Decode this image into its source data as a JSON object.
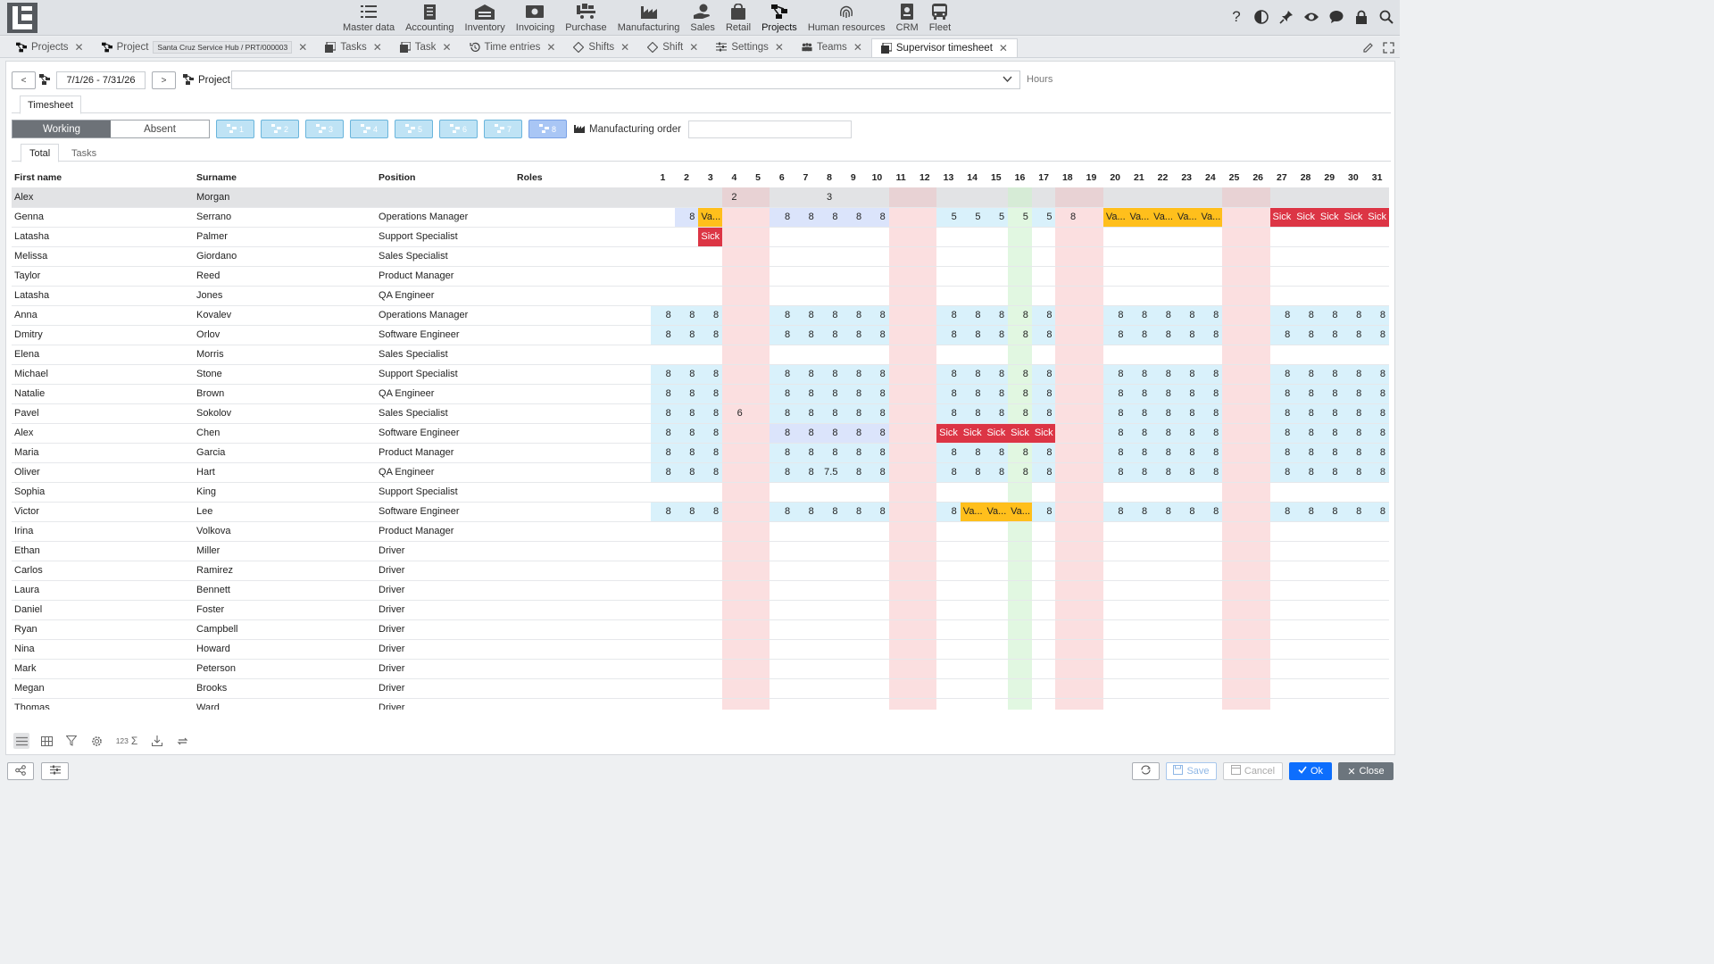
{
  "modules": [
    {
      "label": "Master data",
      "icon": "list-icon"
    },
    {
      "label": "Accounting",
      "icon": "ledger-icon"
    },
    {
      "label": "Inventory",
      "icon": "warehouse-icon"
    },
    {
      "label": "Invoicing",
      "icon": "money-icon"
    },
    {
      "label": "Purchase",
      "icon": "cart-icon"
    },
    {
      "label": "Manufacturing",
      "icon": "factory-icon"
    },
    {
      "label": "Sales",
      "icon": "hand-money-icon"
    },
    {
      "label": "Retail",
      "icon": "bag-icon"
    },
    {
      "label": "Projects",
      "icon": "hierarchy-icon"
    },
    {
      "label": "Human resources",
      "icon": "fingerprint-icon"
    },
    {
      "label": "CRM",
      "icon": "badge-icon"
    },
    {
      "label": "Fleet",
      "icon": "bus-icon"
    }
  ],
  "tabs": [
    {
      "label": "Projects",
      "icon": "hierarchy-icon"
    },
    {
      "label": "Project",
      "icon": "hierarchy-icon",
      "pill": "Santa Cruz Service Hub / PRT/000003"
    },
    {
      "label": "Tasks",
      "icon": "tasks-icon"
    },
    {
      "label": "Task",
      "icon": "tasks-icon"
    },
    {
      "label": "Time entries",
      "icon": "history-icon"
    },
    {
      "label": "Shifts",
      "icon": "shift-icon"
    },
    {
      "label": "Shift",
      "icon": "shift-icon"
    },
    {
      "label": "Settings",
      "icon": "sliders-icon"
    },
    {
      "label": "Teams",
      "icon": "team-icon"
    },
    {
      "label": "Supervisor timesheet",
      "icon": "timesheet-icon",
      "active": true
    }
  ],
  "filter": {
    "prev_label": "<",
    "next_label": ">",
    "date_range": "7/1/26 - 7/31/26",
    "project_label": "Project",
    "project_value": "",
    "hours_label": "Hours"
  },
  "subtab": "Timesheet",
  "mode": {
    "working": "Working",
    "absent": "Absent",
    "active": "Working"
  },
  "shift_buttons": [
    "1",
    "2",
    "3",
    "4",
    "5",
    "6",
    "7",
    "8"
  ],
  "manufacturing_order_label": "Manufacturing order",
  "manufacturing_order_value": "",
  "view_tabs": [
    {
      "label": "Total",
      "active": true
    },
    {
      "label": "Tasks"
    }
  ],
  "table": {
    "headers": {
      "first": "First name",
      "last": "Surname",
      "position": "Position",
      "roles": "Roles"
    },
    "days": [
      "1",
      "2",
      "3",
      "4",
      "5",
      "6",
      "7",
      "8",
      "9",
      "10",
      "11",
      "12",
      "13",
      "14",
      "15",
      "16",
      "17",
      "18",
      "19",
      "20",
      "21",
      "22",
      "23",
      "24",
      "25",
      "26",
      "27",
      "28",
      "29",
      "30",
      "31"
    ],
    "weekend_days": [
      4,
      5,
      11,
      12,
      18,
      19,
      25,
      26
    ],
    "holiday_days": [
      16
    ],
    "rows": [
      {
        "first": "Alex",
        "last": "Morgan",
        "position": "",
        "roles": "",
        "selected": true,
        "cells": {
          "4": "2",
          "8": "3"
        }
      },
      {
        "first": "Genna",
        "last": "Serrano",
        "position": "Operations Manager",
        "roles": "",
        "cells": {
          "2": "8",
          "3": "Va...",
          "6": "8",
          "7": "8",
          "8": "8",
          "9": "8",
          "10": "8",
          "13": "5",
          "14": "5",
          "15": "5",
          "16": "5",
          "17": "5",
          "18": "8",
          "20": "Va...",
          "21": "Va...",
          "22": "Va...",
          "23": "Va...",
          "24": "Va...",
          "27": "Sick",
          "28": "Sick",
          "29": "Sick",
          "30": "Sick",
          "31": "Sick"
        }
      },
      {
        "first": "Latasha",
        "last": "Palmer",
        "position": "Support Specialist",
        "roles": "",
        "cells": {
          "3": "Sick"
        }
      },
      {
        "first": "Melissa",
        "last": "Giordano",
        "position": "Sales Specialist",
        "roles": "",
        "cells": {}
      },
      {
        "first": "Taylor",
        "last": "Reed",
        "position": "Product Manager",
        "roles": "",
        "cells": {}
      },
      {
        "first": "Latasha",
        "last": "Jones",
        "position": "QA Engineer",
        "roles": "",
        "cells": {}
      },
      {
        "first": "Anna",
        "last": "Kovalev",
        "position": "Operations Manager",
        "roles": "",
        "std": true
      },
      {
        "first": "Dmitry",
        "last": "Orlov",
        "position": "Software Engineer",
        "roles": "",
        "std": true
      },
      {
        "first": "Elena",
        "last": "Morris",
        "position": "Sales Specialist",
        "roles": "",
        "cells": {}
      },
      {
        "first": "Michael",
        "last": "Stone",
        "position": "Support Specialist",
        "roles": "",
        "std": true
      },
      {
        "first": "Natalie",
        "last": "Brown",
        "position": "QA Engineer",
        "roles": "",
        "std": true
      },
      {
        "first": "Pavel",
        "last": "Sokolov",
        "position": "Sales Specialist",
        "roles": "",
        "std": true,
        "cells": {
          "4": "6"
        }
      },
      {
        "first": "Alex",
        "last": "Chen",
        "position": "Software Engineer",
        "roles": "",
        "std": true,
        "cells": {
          "13": "Sick",
          "14": "Sick",
          "15": "Sick",
          "16": "Sick",
          "17": "Sick"
        }
      },
      {
        "first": "Maria",
        "last": "Garcia",
        "position": "Product Manager",
        "roles": "",
        "std": true
      },
      {
        "first": "Oliver",
        "last": "Hart",
        "position": "QA Engineer",
        "roles": "",
        "std": true,
        "cells": {
          "8": "7.5"
        }
      },
      {
        "first": "Sophia",
        "last": "King",
        "position": "Support Specialist",
        "roles": "",
        "cells": {}
      },
      {
        "first": "Victor",
        "last": "Lee",
        "position": "Software Engineer",
        "roles": "",
        "std": true,
        "cells": {
          "14": "Va...",
          "15": "Va...",
          "16": "Va..."
        }
      },
      {
        "first": "Irina",
        "last": "Volkova",
        "position": "Product Manager",
        "roles": "",
        "cells": {}
      },
      {
        "first": "Ethan",
        "last": "Miller",
        "position": "Driver",
        "roles": "",
        "cells": {}
      },
      {
        "first": "Carlos",
        "last": "Ramirez",
        "position": "Driver",
        "roles": "",
        "cells": {}
      },
      {
        "first": "Laura",
        "last": "Bennett",
        "position": "Driver",
        "roles": "",
        "cells": {}
      },
      {
        "first": "Daniel",
        "last": "Foster",
        "position": "Driver",
        "roles": "",
        "cells": {}
      },
      {
        "first": "Ryan",
        "last": "Campbell",
        "position": "Driver",
        "roles": "",
        "cells": {}
      },
      {
        "first": "Nina",
        "last": "Howard",
        "position": "Driver",
        "roles": "",
        "cells": {}
      },
      {
        "first": "Mark",
        "last": "Peterson",
        "position": "Driver",
        "roles": "",
        "cells": {}
      },
      {
        "first": "Megan",
        "last": "Brooks",
        "position": "Driver",
        "roles": "",
        "cells": {}
      },
      {
        "first": "Thomas",
        "last": "Ward",
        "position": "Driver",
        "roles": "",
        "cells": {}
      }
    ]
  },
  "grid_tools": {
    "count_label": "123"
  },
  "footer": {
    "save": "Save",
    "cancel": "Cancel",
    "ok": "Ok",
    "close": "Close"
  },
  "colors": {
    "vacation": "#ffbf1c",
    "sick": "#dc3545",
    "working": "#d9f1fb",
    "weekend": "#fbdfe0",
    "holiday": "#e1f7e1",
    "ok": "#0d6efd"
  }
}
